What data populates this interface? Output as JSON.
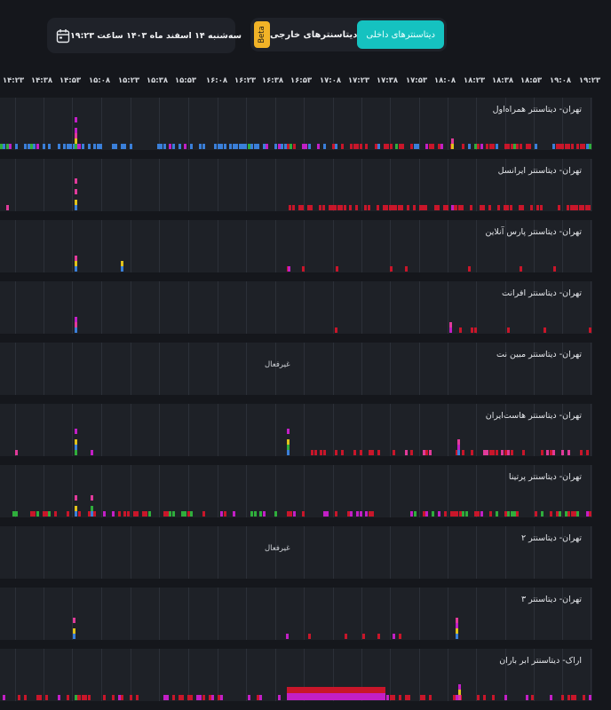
{
  "header": {
    "date_text": "سه‌شنبه ۱۴ اسفند ماه ۱۴۰۳ ساعت ۱۹:۲۳",
    "calendar_icon": "calendar-icon"
  },
  "tabs": {
    "beta_label": "Beta",
    "external_label": "دیتاسنترهای خارجی",
    "internal_label": "دیتاسنترهای داخلی",
    "active": "internal"
  },
  "colors": {
    "accent": "#15c2c0",
    "beta": "#f1b327",
    "down_red": "#c8162a",
    "magenta": "#c21fc6",
    "blue": "#3a7fd9",
    "green": "#2fae3c",
    "yellow": "#e0c21b",
    "pink": "#e03a9a"
  },
  "time_labels": [
    "۱۴:۲۳",
    "۱۴:۳۸",
    "۱۴:۵۳",
    "۱۵:۰۸",
    "۱۵:۲۳",
    "۱۵:۳۸",
    "۱۵:۵۳",
    "۱۶:۰۸",
    "۱۶:۲۳",
    "۱۶:۳۸",
    "۱۶:۵۳",
    "۱۷:۰۸",
    "۱۷:۲۳",
    "۱۷:۳۸",
    "۱۷:۵۳",
    "۱۸:۰۸",
    "۱۸:۲۳",
    "۱۸:۳۸",
    "۱۸:۵۳",
    "۱۹:۰۸",
    "۱۹:۲۳"
  ],
  "datacenters": [
    {
      "name": "تهران- دیتاسنتر همراه‌اول",
      "status": "active"
    },
    {
      "name": "تهران- دیتاسنتر ایرانسل",
      "status": "active"
    },
    {
      "name": "تهران- دیتاسنتر پارس آنلاین",
      "status": "active"
    },
    {
      "name": "تهران- دیتاسنتر افرانت",
      "status": "active"
    },
    {
      "name": "تهران- دیتاسنتر مبین نت",
      "status": "inactive",
      "inactive_text": "غیرفعال"
    },
    {
      "name": "تهران- دیتاسنتر هاست‌ایران",
      "status": "active"
    },
    {
      "name": "تهران- دیتاسنتر پرتینا",
      "status": "active"
    },
    {
      "name": "تهران- دیتاسنتر ۲",
      "status": "inactive",
      "inactive_text": "غیرفعال"
    },
    {
      "name": "تهران- دیتاسنتر ۳",
      "status": "active"
    },
    {
      "name": "اراک- دیتاسنتر ابر باران",
      "status": "active"
    }
  ]
}
